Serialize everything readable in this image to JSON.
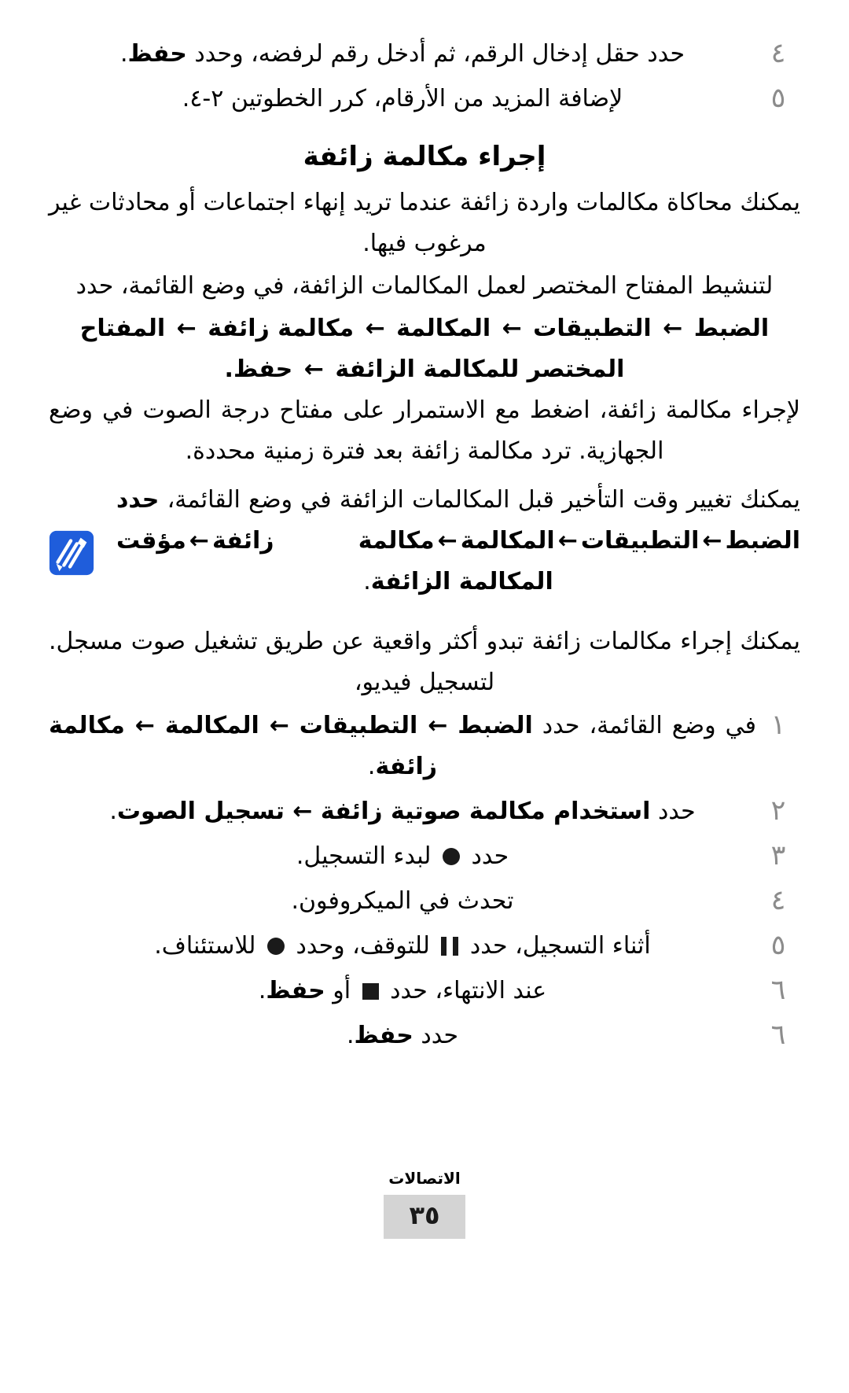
{
  "page": {
    "language": "ar",
    "direction": "rtl"
  },
  "top_list": {
    "items": [
      {
        "marker": "٤",
        "text_before": "حدد حقل إدخال الرقم، ثم أدخل رقم لرفضه، وحدد ",
        "bold": "حفظ",
        "text_after": "."
      },
      {
        "marker": "٥",
        "text_before": "لإضافة المزيد من الأرقام، كرر الخطوتين ٢-٤.",
        "bold": "",
        "text_after": ""
      }
    ]
  },
  "section": {
    "heading": "إجراء مكالمة زائفة",
    "intro_paragraph": "يمكنك محاكاة مكالمات واردة زائفة عندما تريد إنهاء اجتماعات أو محادثات غير مرغوب فيها.",
    "activation_lead": "لتنشيط المفتاح المختصر لعمل المكالمات الزائفة، في وضع القائمة، حدد",
    "breadcrumb": {
      "items": [
        "الضبط",
        "التطبيقات",
        "المكالمة",
        "مكالمة زائفة",
        "المفتاح المختصر للمكالمة الزائفة",
        "حفظ"
      ],
      "separator": "←",
      "trailing_period": "."
    },
    "howto_paragraph": "لإجراء مكالمة زائفة، اضغط مع الاستمرار على مفتاح درجة الصوت في وضع الجهازية. ترد مكالمة زائفة بعد فترة زمنية محددة."
  },
  "note": {
    "icon": "note-pencil-icon",
    "icon_color": "#1f5ddb",
    "text_lead": "يمكنك تغيير وقت التأخير قبل المكالمات الزائفة في وضع القائمة، ",
    "text_bold_lead": "حدد ",
    "breadcrumb": {
      "items": [
        "الضبط",
        "التطبيقات",
        "المكالمة",
        "مكالمة زائفة",
        "مؤقت المكالمة الزائفة"
      ],
      "separator": "←",
      "trailing_period": "."
    }
  },
  "voice": {
    "intro_paragraph": "يمكنك إجراء مكالمات زائفة تبدو أكثر واقعية عن طريق تشغيل صوت مسجل. لتسجيل فيديو،",
    "steps": [
      {
        "marker": "١",
        "segments": [
          {
            "text": "في وضع القائمة، حدد ",
            "bold": false
          },
          {
            "text": "الضبط",
            "bold": true
          },
          {
            "text": " ← ",
            "bold": true
          },
          {
            "text": "التطبيقات",
            "bold": true
          },
          {
            "text": " ← ",
            "bold": true
          },
          {
            "text": "المكالمة",
            "bold": true
          },
          {
            "text": " ← ",
            "bold": true
          },
          {
            "text": "مكالمة زائفة",
            "bold": true
          },
          {
            "text": ".",
            "bold": false
          }
        ]
      },
      {
        "marker": "٢",
        "segments": [
          {
            "text": "حدد ",
            "bold": false
          },
          {
            "text": "استخدام مكالمة صوتية زائفة",
            "bold": true
          },
          {
            "text": " ← ",
            "bold": true
          },
          {
            "text": "تسجيل الصوت",
            "bold": true
          },
          {
            "text": ".",
            "bold": false
          }
        ]
      },
      {
        "marker": "٣",
        "segments": [
          {
            "text": "حدد ",
            "bold": false
          },
          {
            "text": "●",
            "bold": false,
            "glyph": "record-circle"
          },
          {
            "text": " لبدء التسجيل.",
            "bold": false
          }
        ]
      },
      {
        "marker": "٤",
        "segments": [
          {
            "text": "تحدث في الميكروفون.",
            "bold": false
          }
        ]
      },
      {
        "marker": "٥",
        "segments": [
          {
            "text": "أثناء التسجيل، حدد ",
            "bold": false
          },
          {
            "text": "❚❚",
            "bold": false,
            "glyph": "pause"
          },
          {
            "text": " للتوقف، وحدد ",
            "bold": false
          },
          {
            "text": "●",
            "bold": false,
            "glyph": "record-circle"
          },
          {
            "text": " للاستئناف.",
            "bold": false
          }
        ]
      },
      {
        "marker": "٦",
        "segments": [
          {
            "text": "عند الانتهاء، حدد ",
            "bold": false
          },
          {
            "text": "■",
            "bold": false,
            "glyph": "stop-square"
          },
          {
            "text": " أو ",
            "bold": false
          },
          {
            "text": "حفظ",
            "bold": true
          },
          {
            "text": ".",
            "bold": false
          }
        ]
      },
      {
        "marker": "٦",
        "segments": [
          {
            "text": "حدد ",
            "bold": false
          },
          {
            "text": "حفظ",
            "bold": true
          },
          {
            "text": ".",
            "bold": false
          }
        ]
      }
    ]
  },
  "footer": {
    "label": "الاتصالات",
    "page_number": "٣٥",
    "page_box_color": "#d4d4d4"
  }
}
